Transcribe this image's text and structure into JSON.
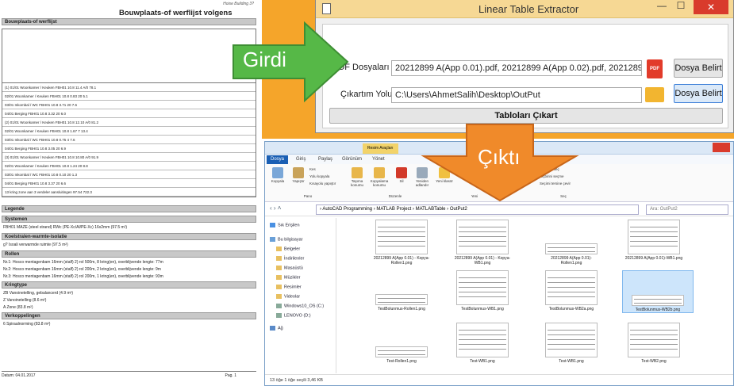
{
  "document": {
    "header_small": "Hoise Building 3?",
    "title": "Bouwplaats-of werflijst volgens verdelers",
    "section_main": "Bouwplaats-of werflijst",
    "rows": [
      "(1) 01/01  Woonkamer / Keuken   FBH01  10.8  11.4  A/0  78.1",
      "02/01  Woonkamer / Keuken   FBH01  10.8  0.83  20  5.1",
      "03/01  Inkombal / WC   FBH01  10.8  3.71  20  7.6",
      "04/01  Berging   FBH01  10.8  3.32  20  6.0",
      "(2) 01/01  Woonkamer / Keuken   FBH01  10.8  12.10  A/0  81.2",
      "02/01  Woonkamer / Keuken   FBH01  10.8  1.67  7  13.4",
      "03/01  Inkombal / WC   FBH01  10.8  0.75  4  7.6",
      "04/01  Berging   FBH01  10.8  3.05  20  6.9",
      "(3) 01/01  Woonkamer / Keuken   FBH01  10.8  10.80  A/0  91.9",
      "02/01  Woonkamer / Keuken   FBH01  10.8  1.24  20  8.8",
      "03/01  Inkombal / WC   FBH01  10.8  0.10  20  1.3",
      "04/01  Berging   FBH01  10.8  3.37  20  6.6",
      "13 kring zone aan 3 verdeler aansluitingen   97.54   722.3"
    ],
    "sections": [
      "Legende",
      "Systemen",
      "Koelstralen-warmte-isolatie",
      "Rollen",
      "Kringtype",
      "Verkoppelingen"
    ],
    "lines": {
      "systemen": "FBH01   MAZE (steel strand) RWc (PE-Xc/Al/PE-Xc) 16x2mm (97.5 m²)",
      "koel": "g?   Isoali verwarmde ruimte (97.5 m²)",
      "r1": "Nr.1: Hosco mentagenbam 16mm (stalf) 2) rol 500m, 8 kring(en), overblijvende lengte: 77m",
      "r2": "Nr.2: Hosco mentagenbam 16mm (stalf) 2) rol 200m, 2 kring(en), overblijvende lengte: 9m",
      "r3": "Nr.3: Hosco mentagenbam 16mm (stalf) 2) rol 200m, 1 kring(en), overblijvende lengte: 93m",
      "k1": "ZB   Vanoinetelling, gebalancerd (4.9 m²)",
      "k2": "Z    Vanoinetelling (8.6 m²)",
      "k3": "A    Zone (83.8 m²)",
      "v1": "6   Spiraalnorming (83.8 m²)"
    },
    "footer_left": "Datum: 04.01.2017",
    "footer_right": "Pag. 1"
  },
  "app": {
    "title": "Linear Table Extractor",
    "minimize": "—",
    "maximize": "☐",
    "close": "✕",
    "pdf_label": "PDF Dosyaları",
    "pdf_value": "20212899 A(App 0.01).pdf, 20212899 A(App 0.02).pdf, 20212899 A(App",
    "out_label": "Çıkartım Yolu",
    "out_value": "C:\\Users\\AhmetSalih\\Desktop\\OutPut",
    "browse1": "Dosya Belirt",
    "browse2": "Dosya Belirt",
    "extract": "Tabloları Çıkart",
    "pdf_icon": "PDF"
  },
  "arrows": {
    "girdi": "Girdi",
    "cikti": "Çıktı"
  },
  "explorer": {
    "tools_tab": "Resim Araçları",
    "tabs": [
      "Dosya",
      "Giriş",
      "Paylaş",
      "Görünüm",
      "Yönet"
    ],
    "ribbon": [
      "Kopyala",
      "Yapıştır",
      "Kes",
      "Yolu kopyala",
      "Kısayolu yapıştır",
      "Taşıma konumu",
      "Kopyalama konumu",
      "Sil",
      "Yeniden adlandır",
      "Yeni klasör",
      "Tümünü seç",
      "Hiçbirini seçme",
      "Seçimi tersine çevir"
    ],
    "ribbon_groups": [
      "Pano",
      "Düzenle",
      "Yeni",
      "Seç"
    ],
    "path": "›  AutoCAD Programming  ›  MATLAB Project  ›  MATLABTable  ›  OutPut2",
    "search": "Ara: OutPut2",
    "nav": [
      "Sık Erişilen",
      "Bu bilgisayar",
      "Belgeler",
      "İndirilenler",
      "Masaüstü",
      "Müzikler",
      "Resimler",
      "Videolar",
      "Windows10_OS (C:)",
      "LENOVO (D:)",
      "Ağ"
    ],
    "files": [
      "20212899 A(App 0.01) - Kopya-Rollen1.png",
      "20212899 A(App 0.01) - Kopya-WB1.png",
      "20212899 A(App 0.01)-Rollen1.png",
      "20212899 A(App 0.01)-WB1.png",
      "TestBolunmus-Rollen1.png",
      "TestBolunmus-WB1.png",
      "TestBolunmus-WB2a.png",
      "TestBolunmus-WB2b.png",
      "Test-Rollen1.png",
      "Test-WB1.png",
      "Test-WB1.png",
      "Test-WB2.png"
    ],
    "status": "13 öğe     1 öğe seçili  3,46 KB"
  }
}
